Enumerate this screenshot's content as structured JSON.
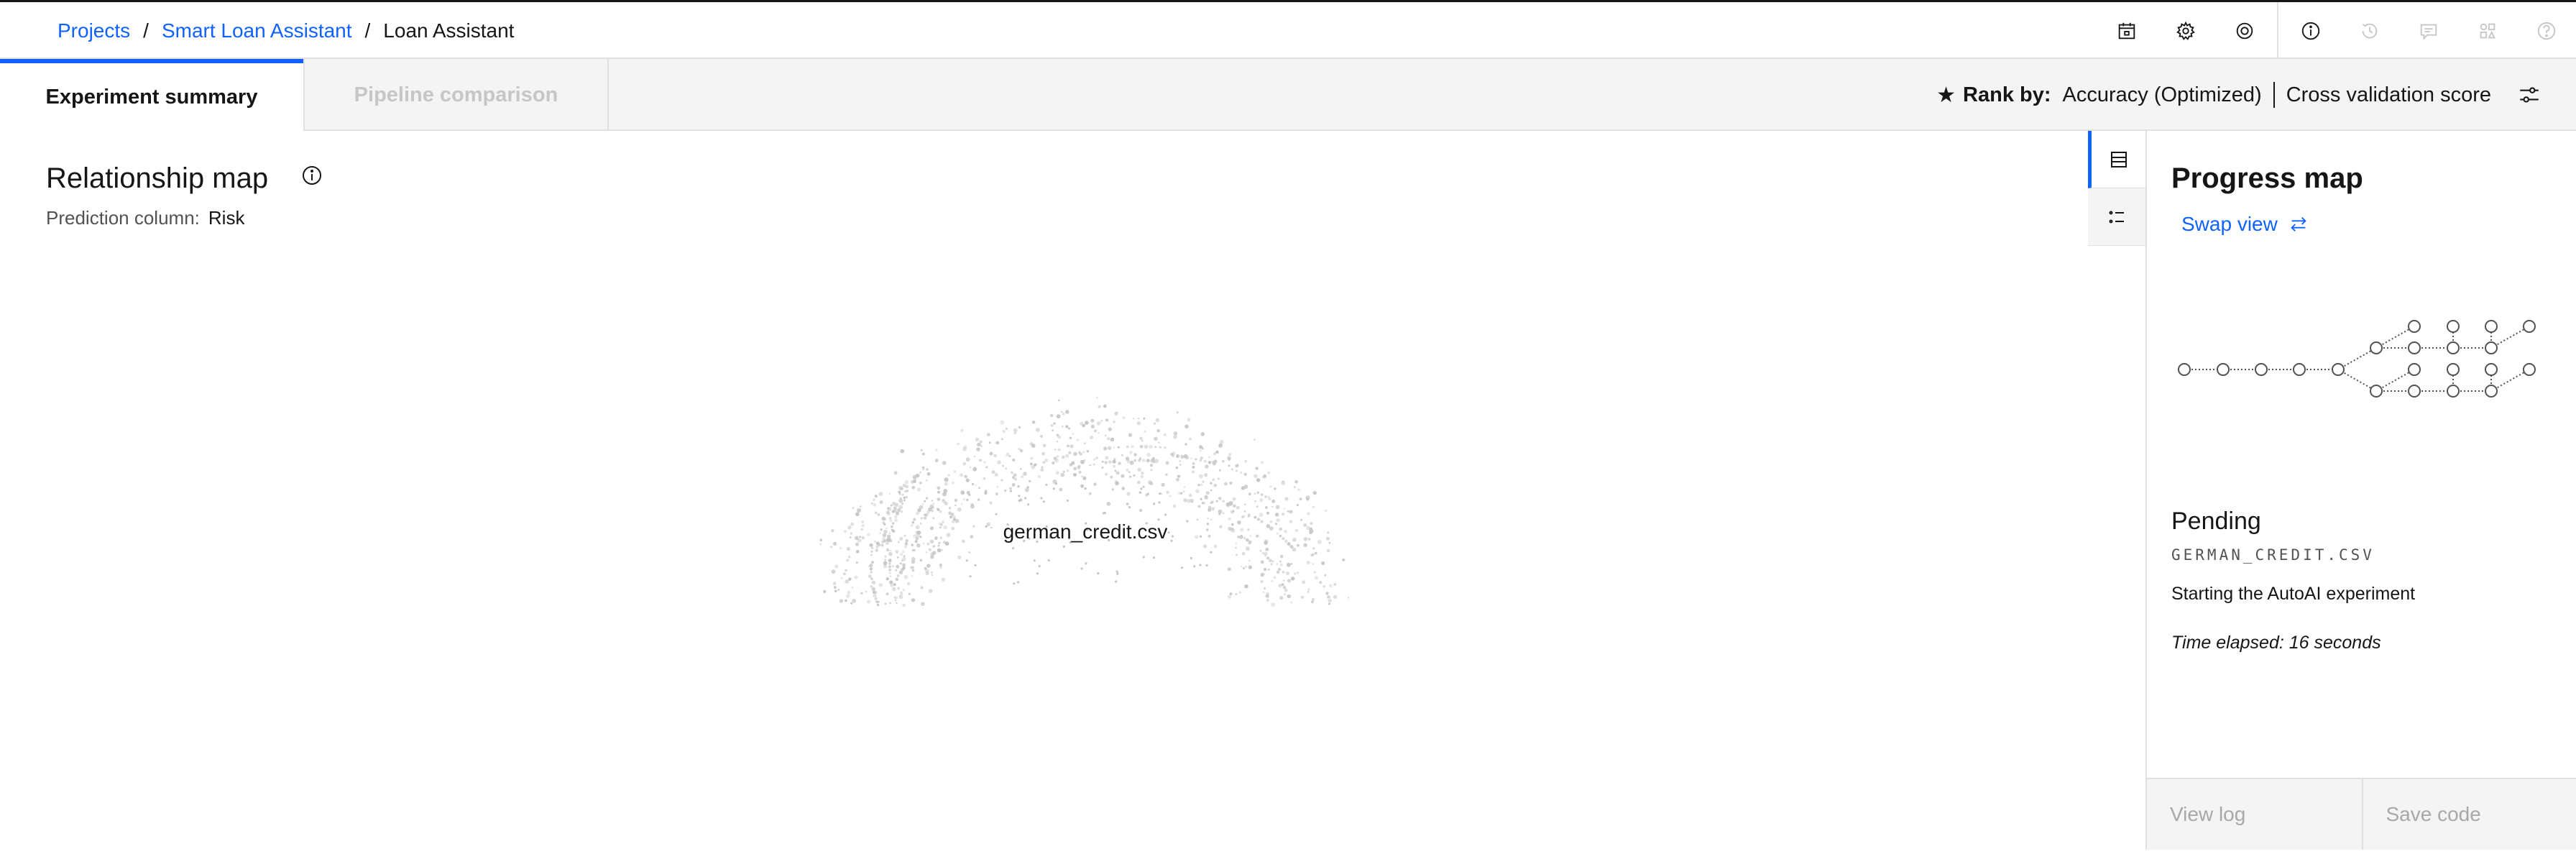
{
  "breadcrumb": {
    "projects": "Projects",
    "project": "Smart Loan Assistant",
    "sep": "/",
    "current": "Loan Assistant"
  },
  "header_icons": [
    "calendar-icon",
    "gear-icon",
    "target-icon",
    "info-icon",
    "history-icon",
    "chat-icon",
    "apps-icon",
    "help-icon"
  ],
  "tabs": {
    "summary": "Experiment summary",
    "comparison": "Pipeline comparison"
  },
  "rank": {
    "star": "★",
    "label": "Rank by:",
    "metric": "Accuracy (Optimized)",
    "score": "Cross validation score"
  },
  "relationship": {
    "title": "Relationship map",
    "prediction_label": "Prediction column:",
    "prediction_value": "Risk",
    "center_label": "german_credit.csv"
  },
  "progress": {
    "title": "Progress map",
    "swap": "Swap view",
    "status": "Pending",
    "filename": "GERMAN_CREDIT.CSV",
    "description": "Starting the AutoAI experiment",
    "elapsed": "Time elapsed: 16 seconds",
    "view_log": "View log",
    "save_code": "Save code"
  },
  "colors": {
    "accent": "#0f62fe",
    "text": "#161616",
    "muted": "#a8a8a8",
    "bg_gray": "#f4f4f4"
  }
}
